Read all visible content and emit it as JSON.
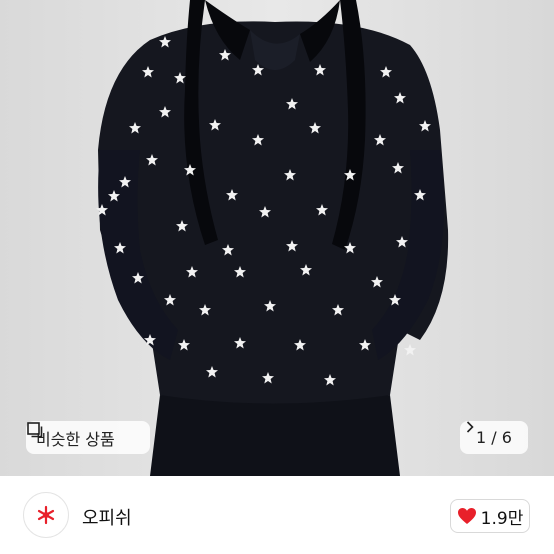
{
  "product": {
    "image_alt": "black star-print hooded sweatshirt",
    "similar_label": "비슷한 상품",
    "pager_text": "1 / 6"
  },
  "seller": {
    "name": "오피쉬"
  },
  "like": {
    "count": "1.9만"
  },
  "colors": {
    "accent_red": "#e8202a",
    "garment": "#15171f"
  },
  "icons": [
    "similar-items-icon",
    "chevron-right-icon",
    "shop-logo-icon",
    "heart-icon"
  ]
}
